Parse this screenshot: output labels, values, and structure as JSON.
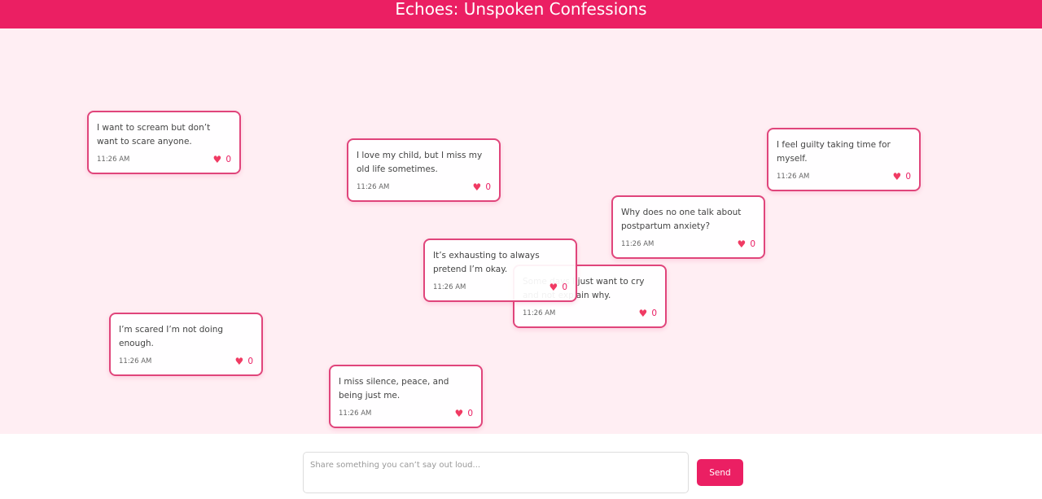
{
  "header": {
    "title": "Echoes: Unspoken Confessions"
  },
  "confessions": [
    {
      "text": "I want to scream but don’t want to scare anyone.",
      "time": "11:26 AM",
      "likes": "0"
    },
    {
      "text": "I love my child, but I miss my old life sometimes.",
      "time": "11:26 AM",
      "likes": "0"
    },
    {
      "text": "I feel guilty taking time for myself.",
      "time": "11:26 AM",
      "likes": "0"
    },
    {
      "text": "Why does no one talk about postpartum anxiety?",
      "time": "11:26 AM",
      "likes": "0"
    },
    {
      "text": "Some days I just want to cry and not explain why.",
      "time": "11:26 AM",
      "likes": "0"
    },
    {
      "text": "It’s exhausting to always pretend I’m okay.",
      "time": "11:26 AM",
      "likes": "0"
    },
    {
      "text": "I’m scared I’m not doing enough.",
      "time": "11:26 AM",
      "likes": "0"
    },
    {
      "text": "I miss silence, peace, and being just me.",
      "time": "11:26 AM",
      "likes": "0"
    }
  ],
  "composer": {
    "placeholder": "Share something you can’t say out loud...",
    "send_label": "Send"
  },
  "colors": {
    "accent": "#eb1f63",
    "background": "#ffeef3"
  }
}
